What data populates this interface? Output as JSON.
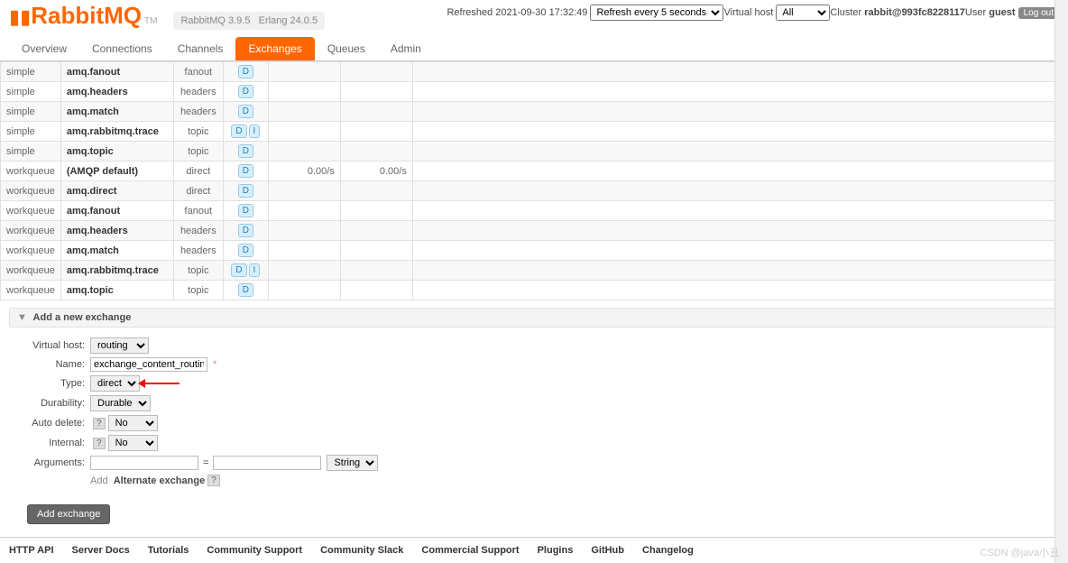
{
  "header": {
    "refreshed": "Refreshed 2021-09-30 17:32:49",
    "refresh_select": "Refresh every 5 seconds",
    "vhost_label": "Virtual host",
    "vhost_select": "All",
    "cluster_label": "Cluster",
    "cluster_value": "rabbit@993fc8228117",
    "user_label": "User",
    "user_value": "guest",
    "logout": "Log out"
  },
  "logo": {
    "text": "RabbitMQ",
    "tm": "TM"
  },
  "versions": {
    "rmq": "RabbitMQ 3.9.5",
    "erlang": "Erlang 24.0.5"
  },
  "tabs": [
    "Overview",
    "Connections",
    "Channels",
    "Exchanges",
    "Queues",
    "Admin"
  ],
  "active_tab": 3,
  "exchanges": [
    {
      "vhost": "simple",
      "name": "amq.fanout",
      "type": "fanout",
      "features": [
        "D"
      ],
      "in": "",
      "out": ""
    },
    {
      "vhost": "simple",
      "name": "amq.headers",
      "type": "headers",
      "features": [
        "D"
      ],
      "in": "",
      "out": ""
    },
    {
      "vhost": "simple",
      "name": "amq.match",
      "type": "headers",
      "features": [
        "D"
      ],
      "in": "",
      "out": ""
    },
    {
      "vhost": "simple",
      "name": "amq.rabbitmq.trace",
      "type": "topic",
      "features": [
        "D",
        "I"
      ],
      "in": "",
      "out": ""
    },
    {
      "vhost": "simple",
      "name": "amq.topic",
      "type": "topic",
      "features": [
        "D"
      ],
      "in": "",
      "out": ""
    },
    {
      "vhost": "workqueue",
      "name": "(AMQP default)",
      "type": "direct",
      "features": [
        "D"
      ],
      "in": "0.00/s",
      "out": "0.00/s"
    },
    {
      "vhost": "workqueue",
      "name": "amq.direct",
      "type": "direct",
      "features": [
        "D"
      ],
      "in": "",
      "out": ""
    },
    {
      "vhost": "workqueue",
      "name": "amq.fanout",
      "type": "fanout",
      "features": [
        "D"
      ],
      "in": "",
      "out": ""
    },
    {
      "vhost": "workqueue",
      "name": "amq.headers",
      "type": "headers",
      "features": [
        "D"
      ],
      "in": "",
      "out": ""
    },
    {
      "vhost": "workqueue",
      "name": "amq.match",
      "type": "headers",
      "features": [
        "D"
      ],
      "in": "",
      "out": ""
    },
    {
      "vhost": "workqueue",
      "name": "amq.rabbitmq.trace",
      "type": "topic",
      "features": [
        "D",
        "I"
      ],
      "in": "",
      "out": ""
    },
    {
      "vhost": "workqueue",
      "name": "amq.topic",
      "type": "topic",
      "features": [
        "D"
      ],
      "in": "",
      "out": ""
    }
  ],
  "section": {
    "title": "Add a new exchange"
  },
  "form": {
    "vhost_label": "Virtual host:",
    "vhost_value": "routing",
    "name_label": "Name:",
    "name_value": "exchange_content_routing",
    "type_label": "Type:",
    "type_value": "direct",
    "durability_label": "Durability:",
    "durability_value": "Durable",
    "autodelete_label": "Auto delete:",
    "autodelete_value": "No",
    "internal_label": "Internal:",
    "internal_value": "No",
    "arguments_label": "Arguments:",
    "arguments_type": "String",
    "add_label": "Add",
    "alternate_label": "Alternate exchange",
    "submit": "Add exchange"
  },
  "footer": [
    "HTTP API",
    "Server Docs",
    "Tutorials",
    "Community Support",
    "Community Slack",
    "Commercial Support",
    "Plugins",
    "GitHub",
    "Changelog"
  ],
  "watermark": "CSDN @java小丑"
}
